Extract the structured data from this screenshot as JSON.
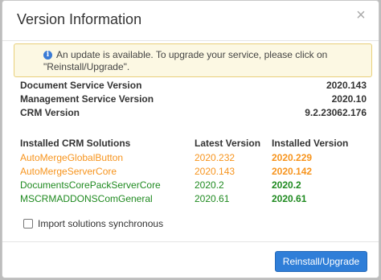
{
  "dialog": {
    "title": "Version Information",
    "close_glyph": "×"
  },
  "alert": {
    "icon": "info-icon",
    "icon_glyph": "i",
    "text": "An update is available. To upgrade your service, please click on \"Reinstall/Upgrade\"."
  },
  "versions": [
    {
      "label": "Document Service Version",
      "value": "2020.143"
    },
    {
      "label": "Management Service Version",
      "value": "2020.10"
    },
    {
      "label": "CRM Version",
      "value": "9.2.23062.176"
    }
  ],
  "solutions": {
    "headers": {
      "name": "Installed CRM Solutions",
      "latest": "Latest Version",
      "installed": "Installed Version"
    },
    "rows": [
      {
        "name": "AutoMergeGlobalButton",
        "latest": "2020.232",
        "installed": "2020.229",
        "status": "outdated"
      },
      {
        "name": "AutoMergeServerCore",
        "latest": "2020.143",
        "installed": "2020.142",
        "status": "outdated"
      },
      {
        "name": "DocumentsCorePackServerCore",
        "latest": "2020.2",
        "installed": "2020.2",
        "status": "current"
      },
      {
        "name": "MSCRMADDONSComGeneral",
        "latest": "2020.61",
        "installed": "2020.61",
        "status": "current"
      }
    ]
  },
  "options": {
    "import_sync_label": "Import solutions synchronous",
    "import_sync_checked": false
  },
  "footer": {
    "primary_button": "Reinstall/Upgrade"
  },
  "colors": {
    "outdated": "#f7941d",
    "current": "#1f8a20",
    "accent": "#2f7ed8",
    "alert_bg": "#fcf8e3"
  }
}
